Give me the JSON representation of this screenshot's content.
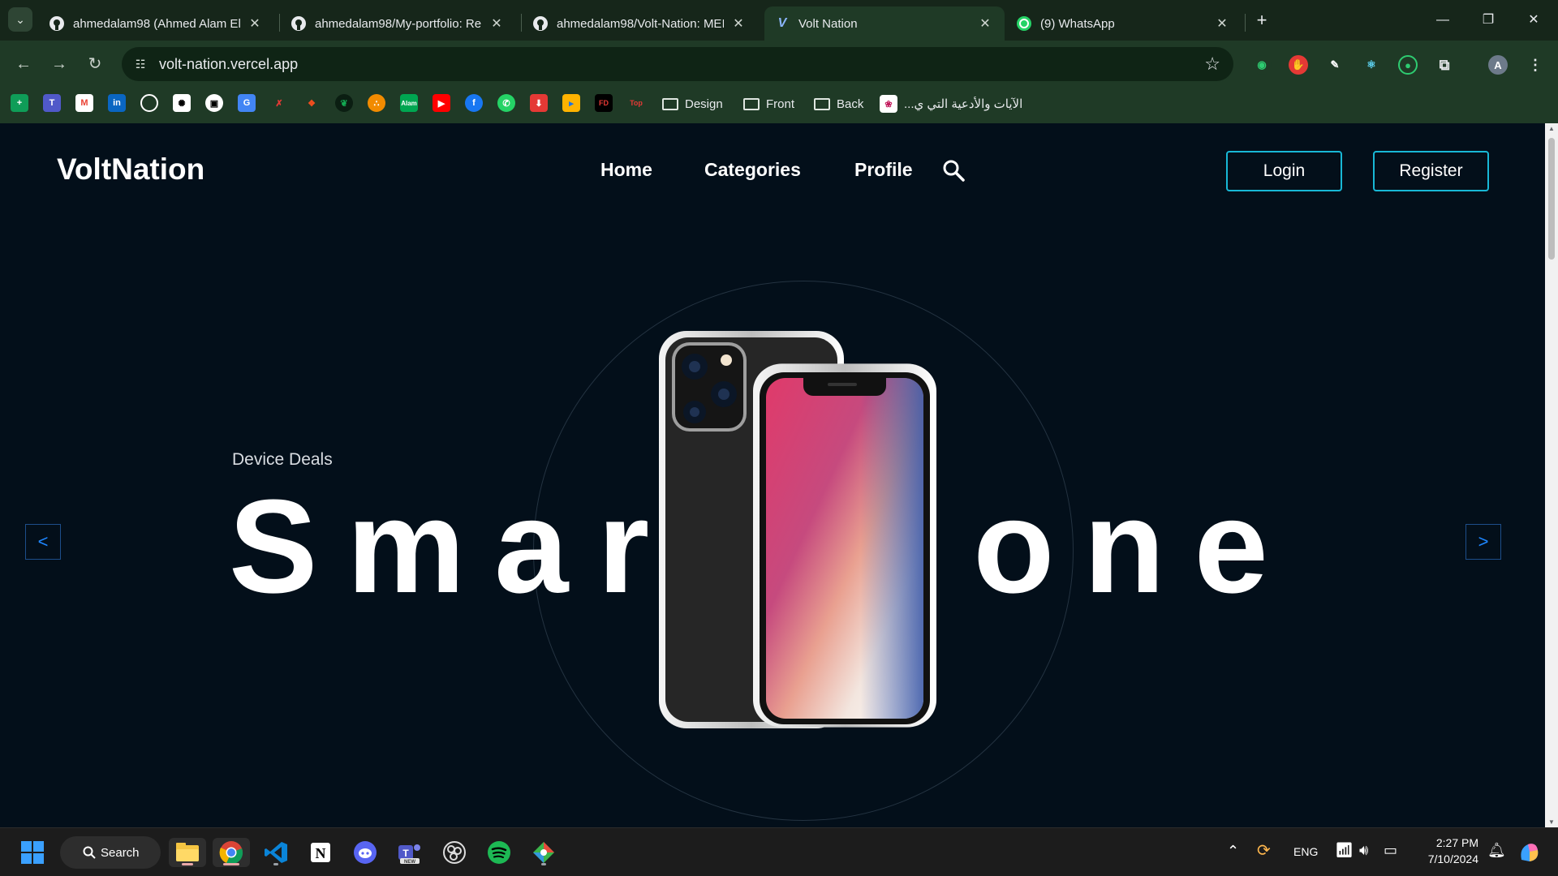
{
  "browser": {
    "tabs": [
      {
        "title": "ahmedalam98 (Ahmed Alam El",
        "icon": "github-icon"
      },
      {
        "title": "ahmedalam98/My-portfolio: Re",
        "icon": "github-icon"
      },
      {
        "title": "ahmedalam98/Volt-Nation: MEI",
        "icon": "github-icon"
      },
      {
        "title": "Volt Nation",
        "icon": "volt-icon"
      },
      {
        "title": "(9) WhatsApp",
        "icon": "whatsapp-icon"
      }
    ],
    "url": "volt-nation.vercel.app",
    "bookmark_folders": [
      "Design",
      "Front",
      "Back"
    ],
    "bookmark_arabic": "الآيات والأدعية التي ي..."
  },
  "site": {
    "brand": "VoltNation",
    "nav": [
      "Home",
      "Categories",
      "Profile"
    ],
    "login": "Login",
    "register": "Register",
    "hero_eyebrow": "Device Deals",
    "hero_title": "Smartphone",
    "prev": "<",
    "next": ">"
  },
  "taskbar": {
    "search": "Search",
    "lang": "ENG",
    "time": "2:27 PM",
    "date": "7/10/2024"
  },
  "colors": {
    "accent": "#18b8d6",
    "page_bg": "#030f1a",
    "chrome": "#1f3a26"
  }
}
